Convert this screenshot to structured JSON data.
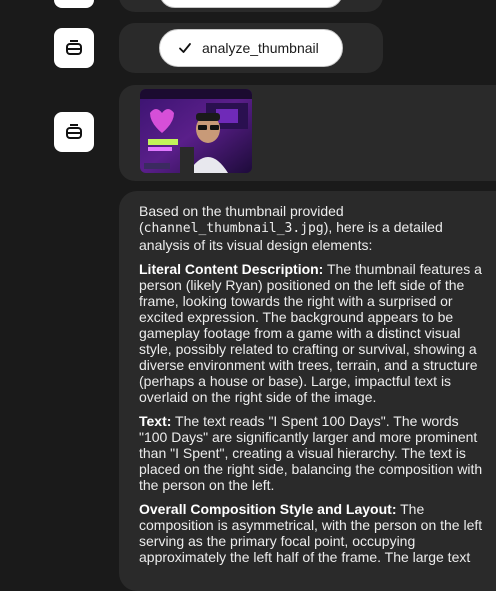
{
  "messages": {
    "tool_call_top": {
      "label": ""
    },
    "tool_call": {
      "label": "analyze_thumbnail"
    },
    "response": {
      "intro_pre": "Based on the thumbnail provided (",
      "intro_code": "channel_thumbnail_3.jpg",
      "intro_post": "), here is a detailed analysis of its visual design elements:",
      "sections": [
        {
          "heading": "Literal Content Description:",
          "body": " The thumbnail features a person (likely Ryan) positioned on the left side of the frame, looking towards the right with a surprised or excited expression. The background appears to be gameplay footage from a game with a distinct visual style, possibly related to crafting or survival, showing a diverse environment with trees, terrain, and a structure (perhaps a house or base). Large, impactful text is overlaid on the right side of the image."
        },
        {
          "heading": "Text:",
          "body": " The text reads \"I Spent 100 Days\". The words \"100 Days\" are significantly larger and more prominent than \"I Spent\", creating a visual hierarchy. The text is placed on the right side, balancing the composition with the person on the left."
        },
        {
          "heading": "Overall Composition Style and Layout:",
          "body": " The composition is asymmetrical, with the person on the left serving as the primary focal point, occupying approximately the left half of the frame. The large text"
        }
      ]
    }
  },
  "icons": {
    "agent_avatar": "robot-icon",
    "check": "check-icon"
  },
  "colors": {
    "background": "#1a1a1a",
    "bubble": "#2a2a2a",
    "pill": "#ffffff"
  }
}
